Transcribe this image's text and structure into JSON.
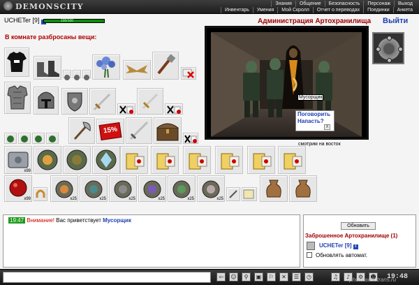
{
  "app": {
    "logo": "DEMONSCITY"
  },
  "menu": {
    "row1": [
      "Знания",
      "Общение",
      "Безопасность",
      "Персонаж",
      "Выход"
    ],
    "row2": [
      "Инвентарь",
      "Умения",
      "Мой Скролл",
      "Отчет о переводах",
      "Поединки",
      "Анкета"
    ]
  },
  "player": {
    "nick": "UCHETer [9]",
    "hp": "100/100"
  },
  "room": {
    "title": "В комнате разбросаны вещи:"
  },
  "items": {
    "discount": "15%",
    "counts": [
      "x99",
      "x99",
      "x25",
      "x25",
      "x25",
      "x25",
      "x25",
      "x25"
    ]
  },
  "scene": {
    "admin_title": "Администрация Артохранилища",
    "exit": "Выйти",
    "npc_tag": "Мусорщик",
    "npc_talk": "Поговорить",
    "npc_attack": "Напасть?",
    "close": "X",
    "looking": "смотрим на восток"
  },
  "chat": {
    "time": "19:47",
    "warning": "Внимание!",
    "greeting": "Вас приветствует",
    "npc": "Мусорщик"
  },
  "room_panel": {
    "refresh": "Обновить",
    "location": "Заброшенное Артохранилище (1)",
    "player": "UCHETer [9]",
    "auto_refresh": "Обновлять автомат."
  },
  "footer": {
    "clock": "19:48",
    "watermark": "photo.artsotrans.ru"
  },
  "colors": {
    "accent_red": "#a00000",
    "link_blue": "#1f3faf",
    "hp_green": "#0d8a0d"
  },
  "icons": [
    "shirt",
    "boots",
    "flowers",
    "hammer",
    "wings",
    "no-sign",
    "armor",
    "helmet",
    "shield",
    "sword",
    "axe",
    "dagger",
    "chest",
    "scroll",
    "potion",
    "rune",
    "dust-bag",
    "compass",
    "info"
  ]
}
